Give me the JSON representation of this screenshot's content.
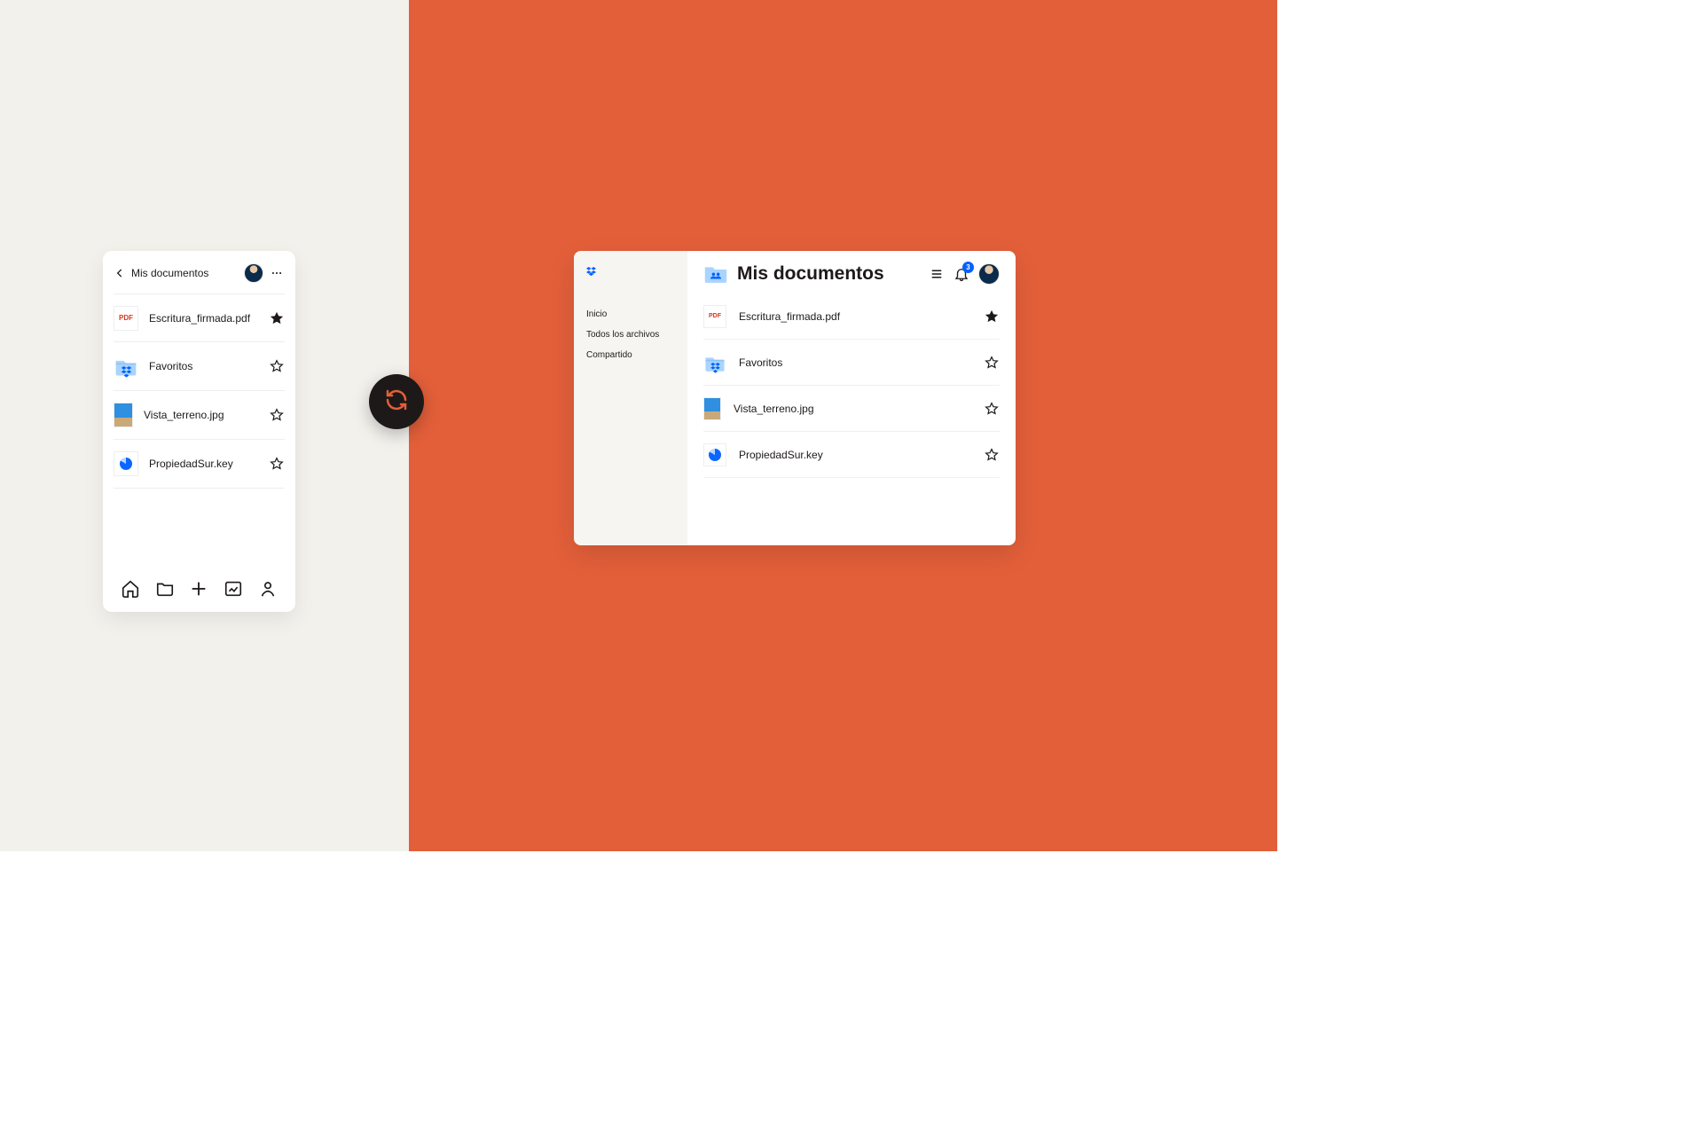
{
  "mobile": {
    "title": "Mis documentos",
    "files": [
      {
        "name": "Escritura_firmada.pdf",
        "type": "pdf",
        "starred": true
      },
      {
        "name": "Favoritos",
        "type": "folder",
        "starred": false
      },
      {
        "name": "Vista_terreno.jpg",
        "type": "image",
        "starred": false
      },
      {
        "name": "PropiedadSur.key",
        "type": "key",
        "starred": false
      }
    ],
    "tabbar": [
      "home",
      "files",
      "add",
      "photos",
      "account"
    ]
  },
  "desktop": {
    "sidebar": {
      "nav": [
        {
          "label": "Inicio"
        },
        {
          "label": "Todos los archivos"
        },
        {
          "label": "Compartido"
        }
      ]
    },
    "header": {
      "title": "Mis documentos",
      "notification_count": "3"
    },
    "files": [
      {
        "name": "Escritura_firmada.pdf",
        "type": "pdf",
        "starred": true
      },
      {
        "name": "Favoritos",
        "type": "folder",
        "starred": false
      },
      {
        "name": "Vista_terreno.jpg",
        "type": "image",
        "starred": false
      },
      {
        "name": "PropiedadSur.key",
        "type": "key",
        "starred": false
      }
    ]
  },
  "icons": {
    "pdf_label": "PDF"
  }
}
